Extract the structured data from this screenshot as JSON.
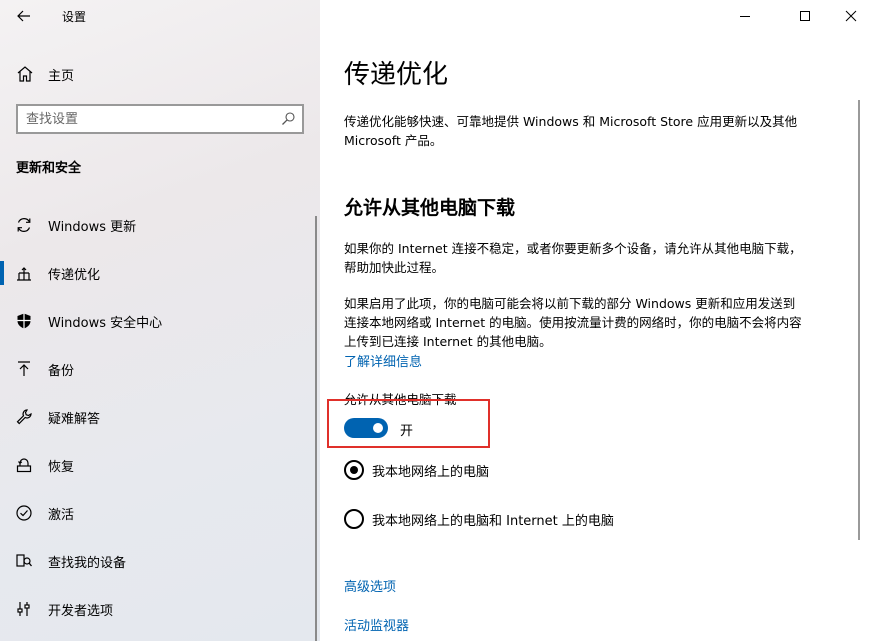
{
  "window": {
    "title": "设置"
  },
  "sidebar": {
    "home_label": "主页",
    "search_placeholder": "查找设置",
    "section_title": "更新和安全",
    "items": [
      {
        "label": "Windows 更新",
        "icon": "refresh-icon"
      },
      {
        "label": "传递优化",
        "icon": "delivery-optimization-icon",
        "selected": true
      },
      {
        "label": "Windows 安全中心",
        "icon": "shield-icon"
      },
      {
        "label": "备份",
        "icon": "backup-arrow-icon"
      },
      {
        "label": "疑难解答",
        "icon": "wrench-icon"
      },
      {
        "label": "恢复",
        "icon": "recovery-icon"
      },
      {
        "label": "激活",
        "icon": "check-circle-icon"
      },
      {
        "label": "查找我的设备",
        "icon": "find-device-icon"
      },
      {
        "label": "开发者选项",
        "icon": "developer-sliders-icon"
      }
    ]
  },
  "main": {
    "title": "传递优化",
    "intro": "传递优化能够快速、可靠地提供 Windows 和 Microsoft Store 应用更新以及其他 Microsoft 产品。",
    "section_heading": "允许从其他电脑下载",
    "para1": "如果你的 Internet 连接不稳定，或者你要更新多个设备，请允许从其他电脑下载，帮助加快此过程。",
    "para2": "如果启用了此项，你的电脑可能会将以前下载的部分 Windows 更新和应用发送到连接本地网络或 Internet 的电脑。使用按流量计费的网络时，你的电脑不会将内容上传到已连接 Internet 的其他电脑。",
    "learn_more": "了解详细信息",
    "toggle_label": "允许从其他电脑下载",
    "toggle_state": "开",
    "toggle_on": true,
    "radio_options": [
      {
        "label": "我本地网络上的电脑",
        "checked": true
      },
      {
        "label": "我本地网络上的电脑和 Internet 上的电脑",
        "checked": false
      }
    ],
    "advanced_link": "高级选项",
    "monitor_link": "活动监视器"
  },
  "colors": {
    "accent": "#0063b1",
    "highlight_box": "#e0302a"
  }
}
